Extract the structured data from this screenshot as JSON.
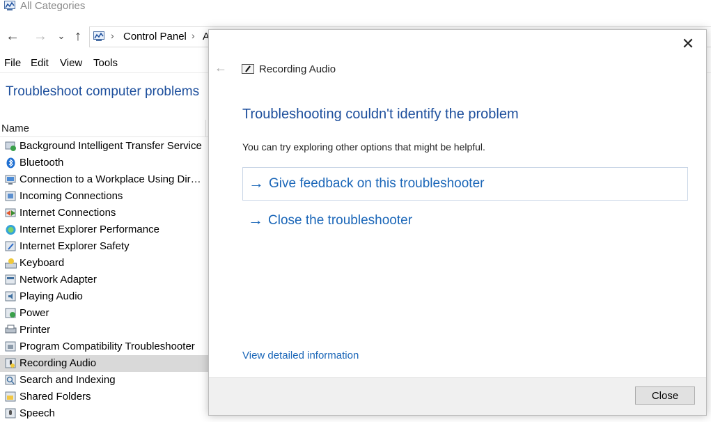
{
  "window": {
    "title": "All Categories"
  },
  "breadcrumb": {
    "items": [
      "Control Panel",
      "A"
    ]
  },
  "menu": {
    "items": [
      "File",
      "Edit",
      "View",
      "Tools"
    ]
  },
  "page": {
    "heading": "Troubleshoot computer problems"
  },
  "list": {
    "column_name": "Name",
    "items": [
      {
        "label": "Background Intelligent Transfer Service",
        "icon": "bits-icon"
      },
      {
        "label": "Bluetooth",
        "icon": "bluetooth-icon"
      },
      {
        "label": "Connection to a Workplace Using DirectAccess",
        "icon": "workplace-connection-icon"
      },
      {
        "label": "Incoming Connections",
        "icon": "incoming-connections-icon"
      },
      {
        "label": "Internet Connections",
        "icon": "internet-connections-icon"
      },
      {
        "label": "Internet Explorer Performance",
        "icon": "ie-performance-icon"
      },
      {
        "label": "Internet Explorer Safety",
        "icon": "ie-safety-icon"
      },
      {
        "label": "Keyboard",
        "icon": "keyboard-icon"
      },
      {
        "label": "Network Adapter",
        "icon": "network-adapter-icon"
      },
      {
        "label": "Playing Audio",
        "icon": "playing-audio-icon"
      },
      {
        "label": "Power",
        "icon": "power-icon"
      },
      {
        "label": "Printer",
        "icon": "printer-icon"
      },
      {
        "label": "Program Compatibility Troubleshooter",
        "icon": "program-compatibility-icon"
      },
      {
        "label": "Recording Audio",
        "icon": "recording-audio-icon",
        "selected": true
      },
      {
        "label": "Search and Indexing",
        "icon": "search-indexing-icon"
      },
      {
        "label": "Shared Folders",
        "icon": "shared-folders-icon"
      },
      {
        "label": "Speech",
        "icon": "speech-icon"
      }
    ]
  },
  "dialog": {
    "app_title": "Recording Audio",
    "heading": "Troubleshooting couldn't identify the problem",
    "text": "You can try exploring other options that might be helpful.",
    "options": [
      {
        "label": "Give feedback on this troubleshooter"
      },
      {
        "label": "Close the troubleshooter"
      }
    ],
    "link": "View detailed information",
    "close_button": "Close"
  },
  "colors": {
    "accent": "#1a66b8",
    "heading": "#1c4e9c",
    "selected_row": "#d9d9d9"
  }
}
